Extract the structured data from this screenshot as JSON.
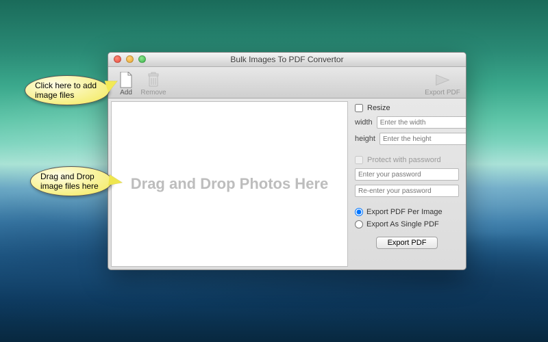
{
  "window": {
    "title": "Bulk Images To PDF Convertor"
  },
  "toolbar": {
    "add_label": "Add",
    "remove_label": "Remove",
    "export_label": "Export PDF"
  },
  "dropzone": {
    "text": "Drag and Drop Photos Here"
  },
  "options": {
    "resize_label": "Resize",
    "width_label": "width",
    "width_placeholder": "Enter the width",
    "height_label": "height",
    "height_placeholder": "Enter the height",
    "protect_label": "Protect with password",
    "password_placeholder": "Enter your password",
    "password_confirm_placeholder": "Re-enter your password",
    "radio_per_image": "Export PDF Per Image",
    "radio_single": "Export As Single PDF",
    "export_button": "Export  PDF"
  },
  "callouts": {
    "add_hint": "Click here to add image files",
    "drop_hint": "Drag and Drop image files here"
  }
}
